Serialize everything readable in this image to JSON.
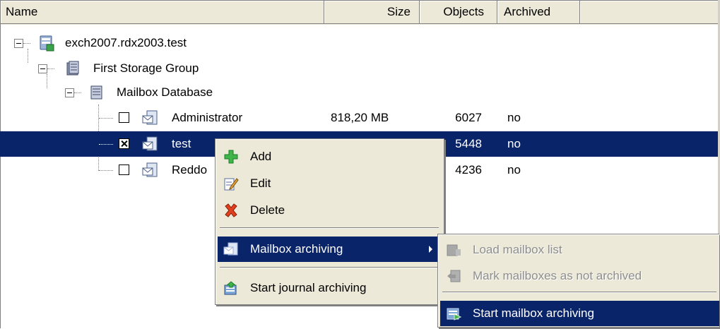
{
  "columns": {
    "name": "Name",
    "size": "Size",
    "objects": "Objects",
    "archived": "Archived"
  },
  "tree": {
    "server": "exch2007.rdx2003.test",
    "storage_group": "First Storage Group",
    "database": "Mailbox Database",
    "mailboxes": [
      {
        "name": "Administrator",
        "size": "818,20 MB",
        "objects": "6027",
        "archived": "no",
        "checked": false
      },
      {
        "name": "test",
        "size": "",
        "objects": "5448",
        "archived": "no",
        "checked": true
      },
      {
        "name": "Reddo",
        "size": "",
        "objects": "4236",
        "archived": "no",
        "checked": false
      }
    ]
  },
  "context_menu": {
    "add": "Add",
    "edit": "Edit",
    "delete": "Delete",
    "mailbox_archiving": "Mailbox archiving",
    "start_journal_archiving": "Start journal archiving"
  },
  "submenu": {
    "load_mailbox_list": "Load mailbox list",
    "mark_not_archived": "Mark mailboxes as not archived",
    "start_mailbox_archiving": "Start mailbox archiving"
  },
  "colors": {
    "selection": "#0a246a",
    "menu_bg": "#ece9d8"
  }
}
